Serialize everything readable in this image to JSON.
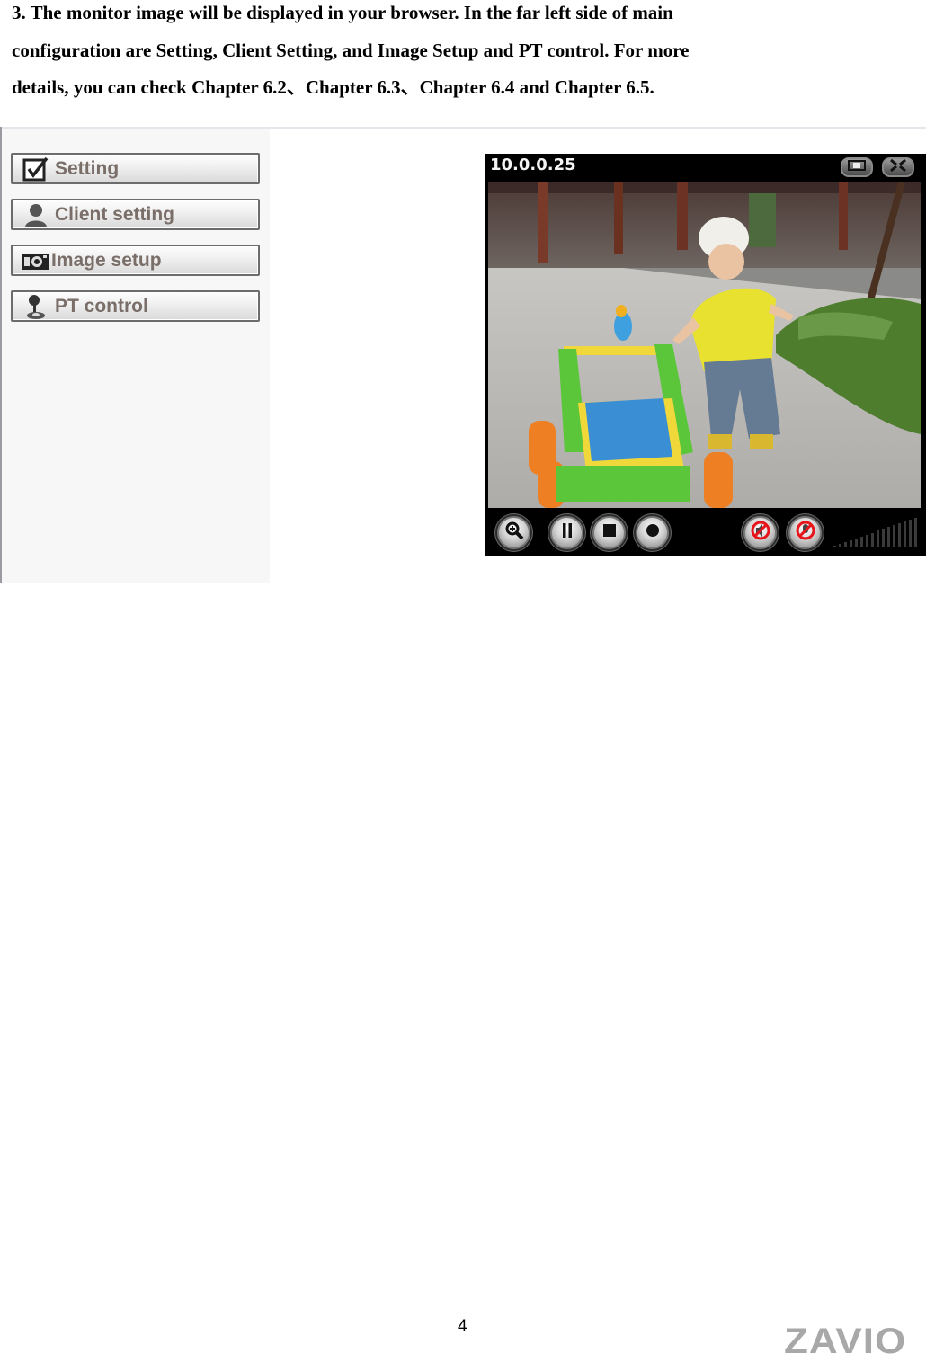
{
  "document": {
    "instruction_lines": [
      "3. The monitor image will be displayed in your browser. In the far left side of main",
      "configuration are Setting, Client Setting, and Image Setup and PT control. For more",
      "details, you can check Chapter 6.2、Chapter 6.3、Chapter 6.4 and Chapter 6.5."
    ],
    "page_number": "4",
    "brand_logo": "ZAVIO"
  },
  "sidebar": {
    "items": [
      {
        "label": "Setting",
        "icon": "checkbox-icon"
      },
      {
        "label": "Client setting",
        "icon": "user-icon"
      },
      {
        "label": "Image setup",
        "icon": "camera-icon"
      },
      {
        "label": "PT control",
        "icon": "joystick-icon"
      }
    ]
  },
  "viewer": {
    "camera_address": "10.0.0.25",
    "header_buttons": [
      {
        "icon": "snapshot-mode-icon"
      },
      {
        "icon": "fullscreen-icon"
      }
    ],
    "controls": [
      {
        "icon": "zoom-in-icon"
      },
      {
        "icon": "pause-icon"
      },
      {
        "icon": "stop-icon"
      },
      {
        "icon": "record-icon"
      },
      {
        "icon": "speaker-muted-icon"
      },
      {
        "icon": "microphone-muted-icon"
      }
    ],
    "volume_level": 0,
    "colors": {
      "background": "#000000",
      "mute_red": "#e8141c"
    }
  }
}
